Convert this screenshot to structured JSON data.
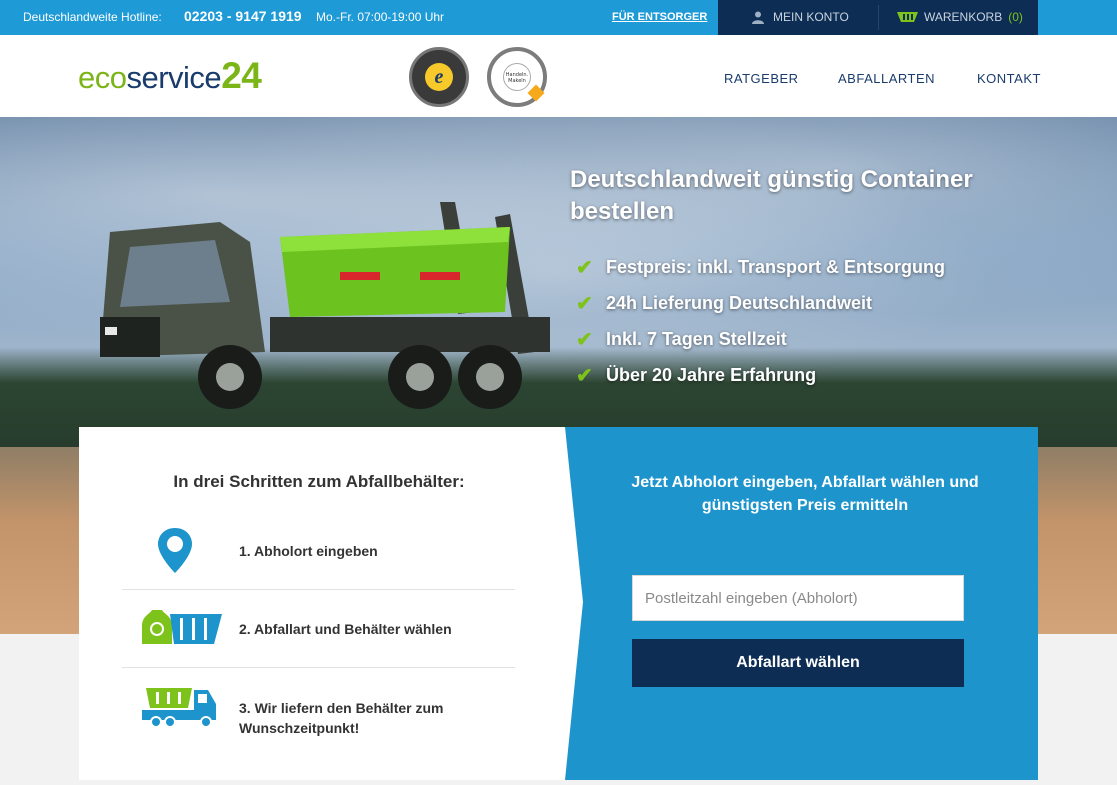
{
  "topbar": {
    "hotline_label": "Deutschlandweite Hotline:",
    "phone": "02203 - 9147 1919",
    "hours": "Mo.-Fr. 07:00-19:00 Uhr",
    "entsorger_link": "FÜR ENTSORGER",
    "account_label": "MEIN KONTO",
    "cart_label": "WARENKORB",
    "cart_count": "(0)"
  },
  "header": {
    "logo": {
      "eco": "eco",
      "service": "service",
      "num": "24"
    },
    "seal1_letter": "e",
    "seal2_text": "Handeln. Makeln",
    "nav": [
      "RATGEBER",
      "ABFALLARTEN",
      "KONTAKT"
    ]
  },
  "hero": {
    "title": "Deutschlandweit günstig Container bestellen",
    "benefits": [
      "Festpreis: inkl. Transport & Entsorgung",
      "24h Lieferung Deutschlandweit",
      "Inkl. 7 Tagen Stellzeit",
      "Über 20 Jahre Erfahrung"
    ]
  },
  "steps": {
    "title": "In drei Schritten zum Abfallbehälter:",
    "items": [
      {
        "label": "1. Abholort eingeben",
        "icon": "location-pin-icon"
      },
      {
        "label": "2. Abfallart und Behälter wählen",
        "icon": "waste-container-icon"
      },
      {
        "label": "3. Wir liefern den Behälter zum Wunschzeitpunkt!",
        "icon": "delivery-truck-icon"
      }
    ]
  },
  "order": {
    "title": "Jetzt Abholort eingeben, Abfallart wählen und günstigsten Preis ermitteln",
    "zip_placeholder": "Postleitzahl eingeben (Abholort)",
    "zip_value": "",
    "button_label": "Abfallart wählen"
  },
  "colors": {
    "topbar": "#1e9ad6",
    "dark_navy": "#0d2d55",
    "brand_green": "#7cb518",
    "panel_blue": "#1e94cc",
    "icon_blue": "#1e94cc",
    "icon_green": "#7ec31b"
  }
}
